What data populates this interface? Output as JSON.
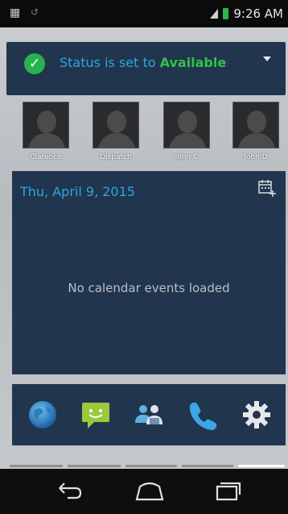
{
  "status_bar": {
    "time": "9:26 AM"
  },
  "status_widget": {
    "prefix": "Status is set to ",
    "value": "Available",
    "check_icon": "check-circle-icon",
    "dropdown_icon": "caret-down-icon"
  },
  "contacts": [
    {
      "name": "Clarence"
    },
    {
      "name": "Dispatch"
    },
    {
      "name": "John C"
    },
    {
      "name": "John D"
    }
  ],
  "calendar": {
    "date": "Thu, April 9, 2015",
    "empty_message": "No calendar events loaded",
    "add_icon": "calendar-add-icon"
  },
  "dock": {
    "items": [
      "globe-icon",
      "message-icon",
      "contacts-icon",
      "phone-icon",
      "settings-icon"
    ]
  },
  "nav": {
    "items": [
      "back-icon",
      "home-icon",
      "recents-icon"
    ]
  },
  "colors": {
    "card": "#22354e",
    "accent_blue": "#2aa8e0",
    "available_green": "#31c24a"
  }
}
